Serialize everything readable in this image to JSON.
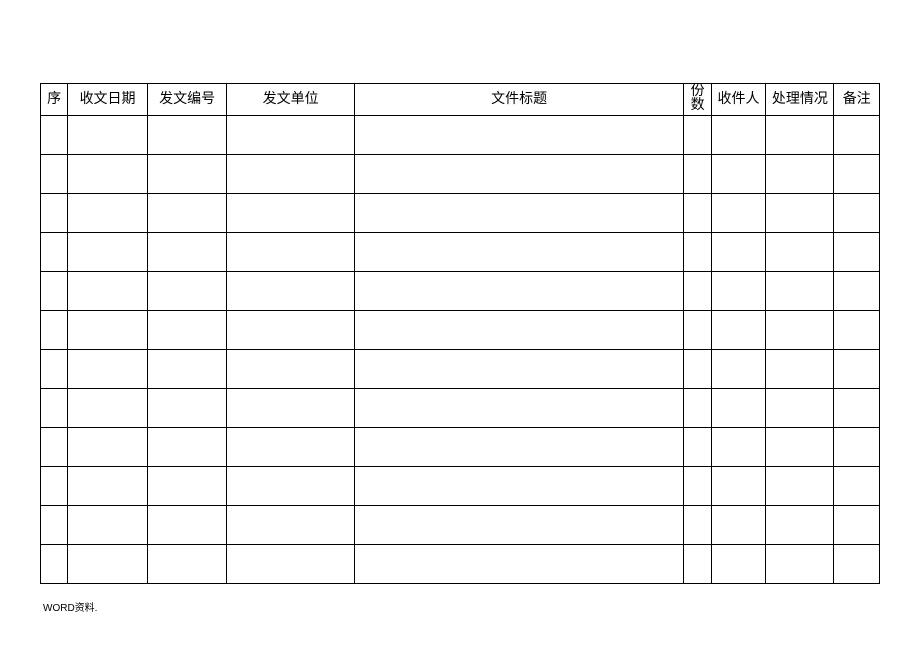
{
  "table": {
    "headers": {
      "seq": "序",
      "date": "收文日期",
      "docno": "发文编号",
      "unit": "发文单位",
      "title": "文件标题",
      "copies": "份数",
      "recipient": "收件人",
      "status": "处理情况",
      "remark": "备注"
    },
    "rows": [
      {
        "seq": "",
        "date": "",
        "docno": "",
        "unit": "",
        "title": "",
        "copies": "",
        "recipient": "",
        "status": "",
        "remark": ""
      },
      {
        "seq": "",
        "date": "",
        "docno": "",
        "unit": "",
        "title": "",
        "copies": "",
        "recipient": "",
        "status": "",
        "remark": ""
      },
      {
        "seq": "",
        "date": "",
        "docno": "",
        "unit": "",
        "title": "",
        "copies": "",
        "recipient": "",
        "status": "",
        "remark": ""
      },
      {
        "seq": "",
        "date": "",
        "docno": "",
        "unit": "",
        "title": "",
        "copies": "",
        "recipient": "",
        "status": "",
        "remark": ""
      },
      {
        "seq": "",
        "date": "",
        "docno": "",
        "unit": "",
        "title": "",
        "copies": "",
        "recipient": "",
        "status": "",
        "remark": ""
      },
      {
        "seq": "",
        "date": "",
        "docno": "",
        "unit": "",
        "title": "",
        "copies": "",
        "recipient": "",
        "status": "",
        "remark": ""
      },
      {
        "seq": "",
        "date": "",
        "docno": "",
        "unit": "",
        "title": "",
        "copies": "",
        "recipient": "",
        "status": "",
        "remark": ""
      },
      {
        "seq": "",
        "date": "",
        "docno": "",
        "unit": "",
        "title": "",
        "copies": "",
        "recipient": "",
        "status": "",
        "remark": ""
      },
      {
        "seq": "",
        "date": "",
        "docno": "",
        "unit": "",
        "title": "",
        "copies": "",
        "recipient": "",
        "status": "",
        "remark": ""
      },
      {
        "seq": "",
        "date": "",
        "docno": "",
        "unit": "",
        "title": "",
        "copies": "",
        "recipient": "",
        "status": "",
        "remark": ""
      },
      {
        "seq": "",
        "date": "",
        "docno": "",
        "unit": "",
        "title": "",
        "copies": "",
        "recipient": "",
        "status": "",
        "remark": ""
      },
      {
        "seq": "",
        "date": "",
        "docno": "",
        "unit": "",
        "title": "",
        "copies": "",
        "recipient": "",
        "status": "",
        "remark": ""
      }
    ]
  },
  "footer": "WORD资料."
}
